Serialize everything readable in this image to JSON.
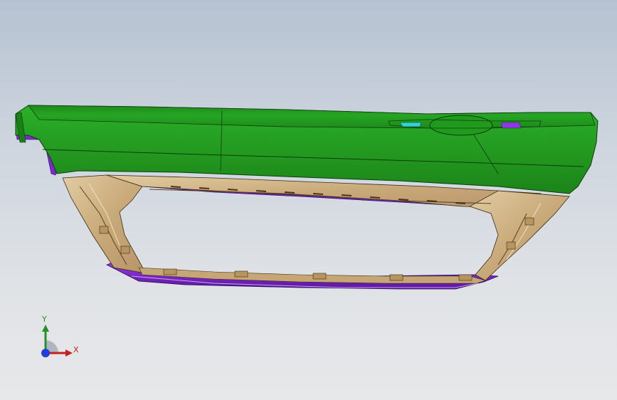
{
  "viewport": {
    "background_top": "#b6c2d2",
    "background_bottom": "#e7e8ea"
  },
  "model": {
    "outer_panel_color": "#23a021",
    "inner_panel_color": "#d4b98e",
    "seal_color": "#7a22d0",
    "accent_color": "#2fd0d8",
    "edge_color": "#1a1a1a"
  },
  "triad": {
    "y_label": "Y",
    "x_label": "X",
    "y_color": "#2a8f2a",
    "x_color": "#c42020",
    "z_color": "#1f3fd8"
  }
}
